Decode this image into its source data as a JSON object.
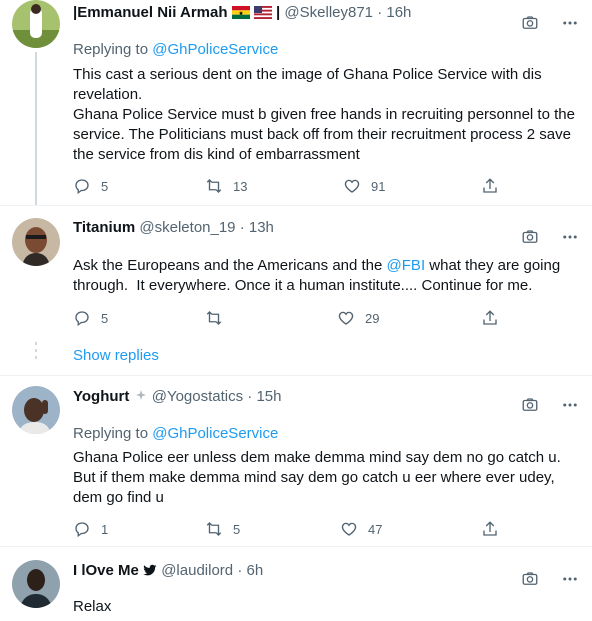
{
  "tweets": [
    {
      "name": "|Emmanuel Nii Armah",
      "name_suffix": "|",
      "handle": "@Skelley871",
      "dot": "·",
      "time": "16h",
      "replying_label": "Replying to",
      "replying_to": "@GhPoliceService",
      "text": "This cast a serious dent on the image of Ghana Police Service with dis revelation.\nGhana Police Service must b given free hands in recruiting personnel to the service. The Politicians must back off from their recruitment process 2 save the service from dis kind of embarrassment",
      "replies": "5",
      "retweets": "13",
      "likes": "91"
    },
    {
      "name": "Titanium",
      "handle": "@skeleton_19",
      "dot": "·",
      "time": "13h",
      "text_before": "Ask the Europeans and the Americans and the ",
      "text_mention": "@FBI",
      "text_after": " what they are going through.  It everywhere. Once it a human institute.... Continue for me.",
      "replies": "5",
      "retweets": "",
      "likes": "29"
    },
    {
      "name": "Yoghurt",
      "handle": "@Yogostatics",
      "dot": "·",
      "time": "15h",
      "replying_label": "Replying to",
      "replying_to": "@GhPoliceService",
      "text": "Ghana Police eer unless dem make demma mind say dem no go catch u.\nBut if them make demma mind say dem go catch u eer where ever udey, dem go find u",
      "replies": "1",
      "retweets": "5",
      "likes": "47"
    },
    {
      "name": "I lOve Me",
      "handle": "@laudilord",
      "dot": "·",
      "time": "6h",
      "text": "Relax"
    }
  ],
  "show_replies": "Show replies",
  "colors": {
    "accent": "#1d9bf0",
    "secondary": "#536471",
    "text": "#0f1419"
  }
}
